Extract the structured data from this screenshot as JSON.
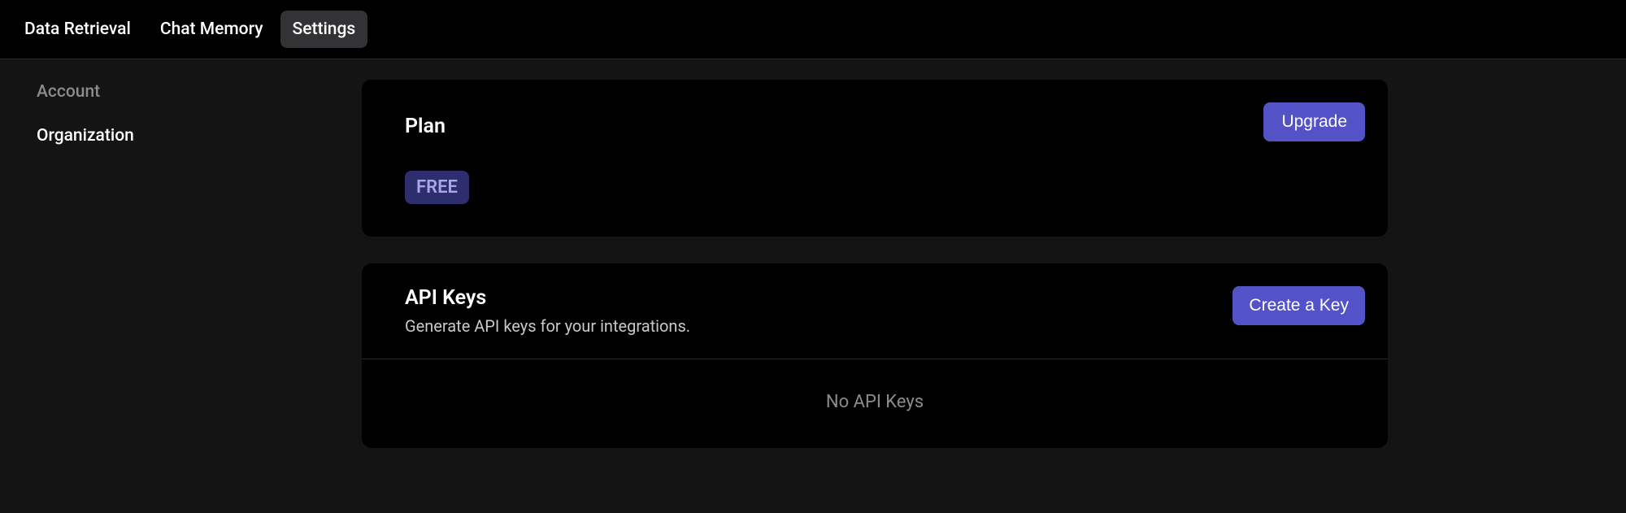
{
  "topNav": {
    "items": [
      {
        "label": "Data Retrieval",
        "active": false
      },
      {
        "label": "Chat Memory",
        "active": false
      },
      {
        "label": "Settings",
        "active": true
      }
    ]
  },
  "sidebar": {
    "items": [
      {
        "label": "Account",
        "active": true
      },
      {
        "label": "Organization",
        "active": false
      }
    ]
  },
  "planCard": {
    "title": "Plan",
    "badge": "FREE",
    "upgradeLabel": "Upgrade"
  },
  "apiKeysCard": {
    "title": "API Keys",
    "subtitle": "Generate API keys for your integrations.",
    "createLabel": "Create a Key",
    "emptyMessage": "No API Keys"
  }
}
